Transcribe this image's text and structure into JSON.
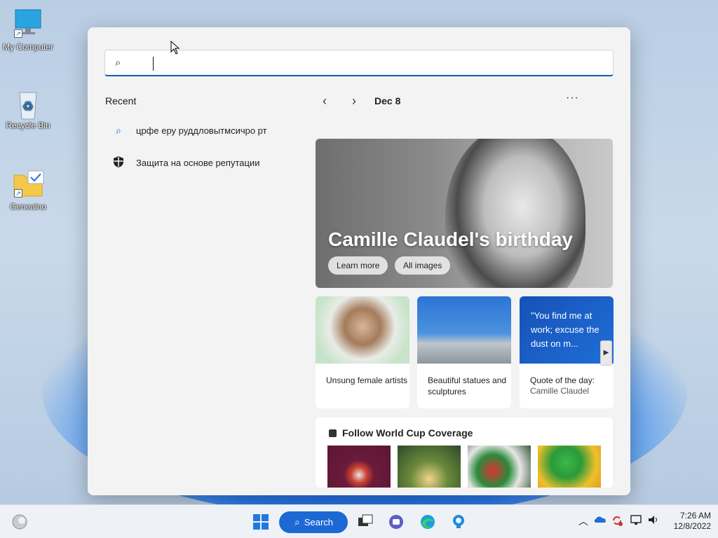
{
  "desktop": {
    "icons": [
      {
        "label": "My Computer"
      },
      {
        "label": "Recycle Bin"
      },
      {
        "label": "Genealno"
      }
    ]
  },
  "search": {
    "value": "",
    "placeholder": ""
  },
  "recent": {
    "title": "Recent",
    "items": [
      {
        "label": "црфе еру руддловытмсичро рт",
        "icon": "search-icon"
      },
      {
        "label": "Защита на основе репутации",
        "icon": "shield-icon"
      }
    ]
  },
  "highlights": {
    "date": "Dec 8",
    "more": "···",
    "hero": {
      "title": "Camille Claudel's birthday",
      "learn_more": "Learn more",
      "all_images": "All images"
    },
    "cards": [
      {
        "caption": "Unsung female artists"
      },
      {
        "caption": "Beautiful statues and sculptures"
      },
      {
        "quote": "\"You find me at work; excuse the dust on m...",
        "caption": "Quote of the day:",
        "sub": "Camille Claudel"
      }
    ],
    "worldcup": {
      "title": "Follow World Cup Coverage"
    }
  },
  "taskbar": {
    "search_label": "Search",
    "time": "7:26 AM",
    "date": "12/8/2022"
  },
  "colors": {
    "accent": "#1c69d4",
    "search_underline": "#0a5fb4"
  }
}
